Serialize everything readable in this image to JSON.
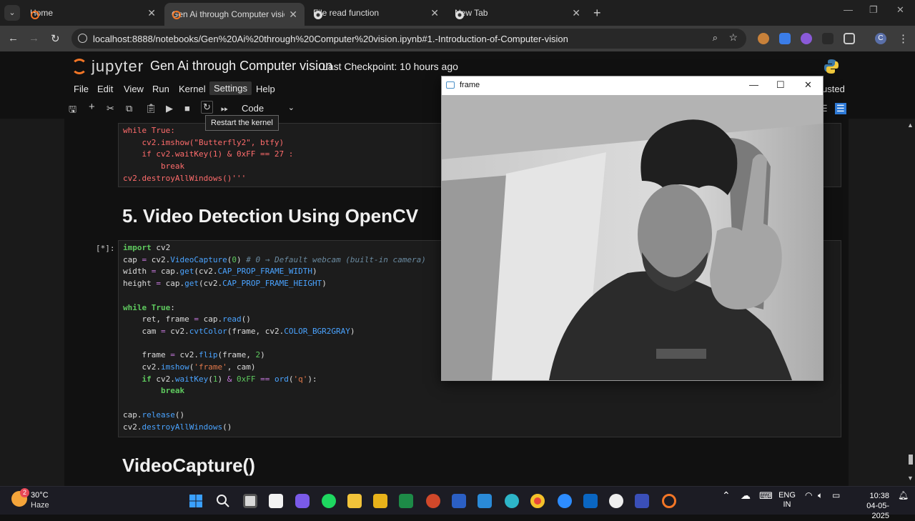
{
  "browser": {
    "tabs": [
      {
        "label": "Home",
        "active": false
      },
      {
        "label": "Gen Ai through Computer visio",
        "active": true
      },
      {
        "label": "File read function",
        "active": false
      },
      {
        "label": "New Tab",
        "active": false
      }
    ],
    "url": "localhost:8888/notebooks/Gen%20Ai%20through%20Computer%20vision.ipynb#1.-Introduction-of-Computer-vision",
    "profile_letter": "C"
  },
  "jupyter": {
    "logo_text": "jupyter",
    "notebook_title": "Gen Ai through Computer vision",
    "checkpoint": "Last Checkpoint: 10 hours ago",
    "menu": [
      "File",
      "Edit",
      "View",
      "Run",
      "Kernel",
      "Settings",
      "Help"
    ],
    "trusted": "usted",
    "cell_type": "Code",
    "tooltip": "Restart the kernel"
  },
  "notebook": {
    "cell1_lines": [
      "while True:",
      "    cv2.imshow(\"Butterfly2\", btfy)",
      "    if cv2.waitKey(1) & 0xFF == 27 :",
      "        break",
      "cv2.destroyAllWindows()'''"
    ],
    "heading1": "5. Video Detection Using OpenCV",
    "prompt": "[*]:",
    "heading2": "VideoCapture()"
  },
  "frame_window": {
    "title": "frame"
  },
  "taskbar": {
    "weather_temp": "30°C",
    "weather_desc": "Haze",
    "weather_badge": "2",
    "lang1": "ENG",
    "lang2": "IN",
    "time": "10:38",
    "date": "04-05-2025"
  }
}
